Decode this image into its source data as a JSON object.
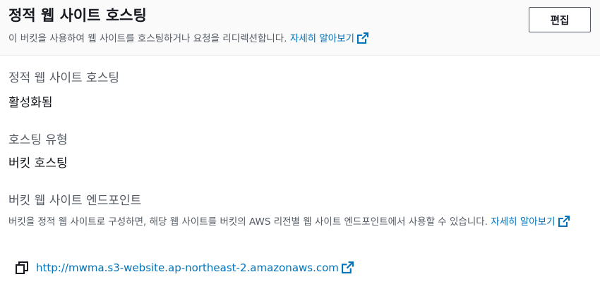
{
  "header": {
    "title": "정적 웹 사이트 호스팅",
    "description": "이 버킷을 사용하여 웹 사이트를 호스팅하거나 요청을 리디렉션합니다.",
    "learn_more": "자세히 알아보기",
    "edit_label": "편집"
  },
  "hosting_status": {
    "label": "정적 웹 사이트 호스팅",
    "value": "활성화됨"
  },
  "hosting_type": {
    "label": "호스팅 유형",
    "value": "버킷 호스팅"
  },
  "endpoint": {
    "label": "버킷 웹 사이트 엔드포인트",
    "description": "버킷을 정적 웹 사이트로 구성하면, 해당 웹 사이트를 버킷의 AWS 리전별 웹 사이트 엔드포인트에서 사용할 수 있습니다.",
    "learn_more": "자세히 알아보기",
    "url": "http://mwma.s3-website.ap-northeast-2.amazonaws.com"
  },
  "icons": {
    "external_link": "external-link-icon",
    "copy": "copy-icon"
  },
  "colors": {
    "link": "#0073bb",
    "secondary_text": "#545b64",
    "primary_text": "#16191f"
  }
}
